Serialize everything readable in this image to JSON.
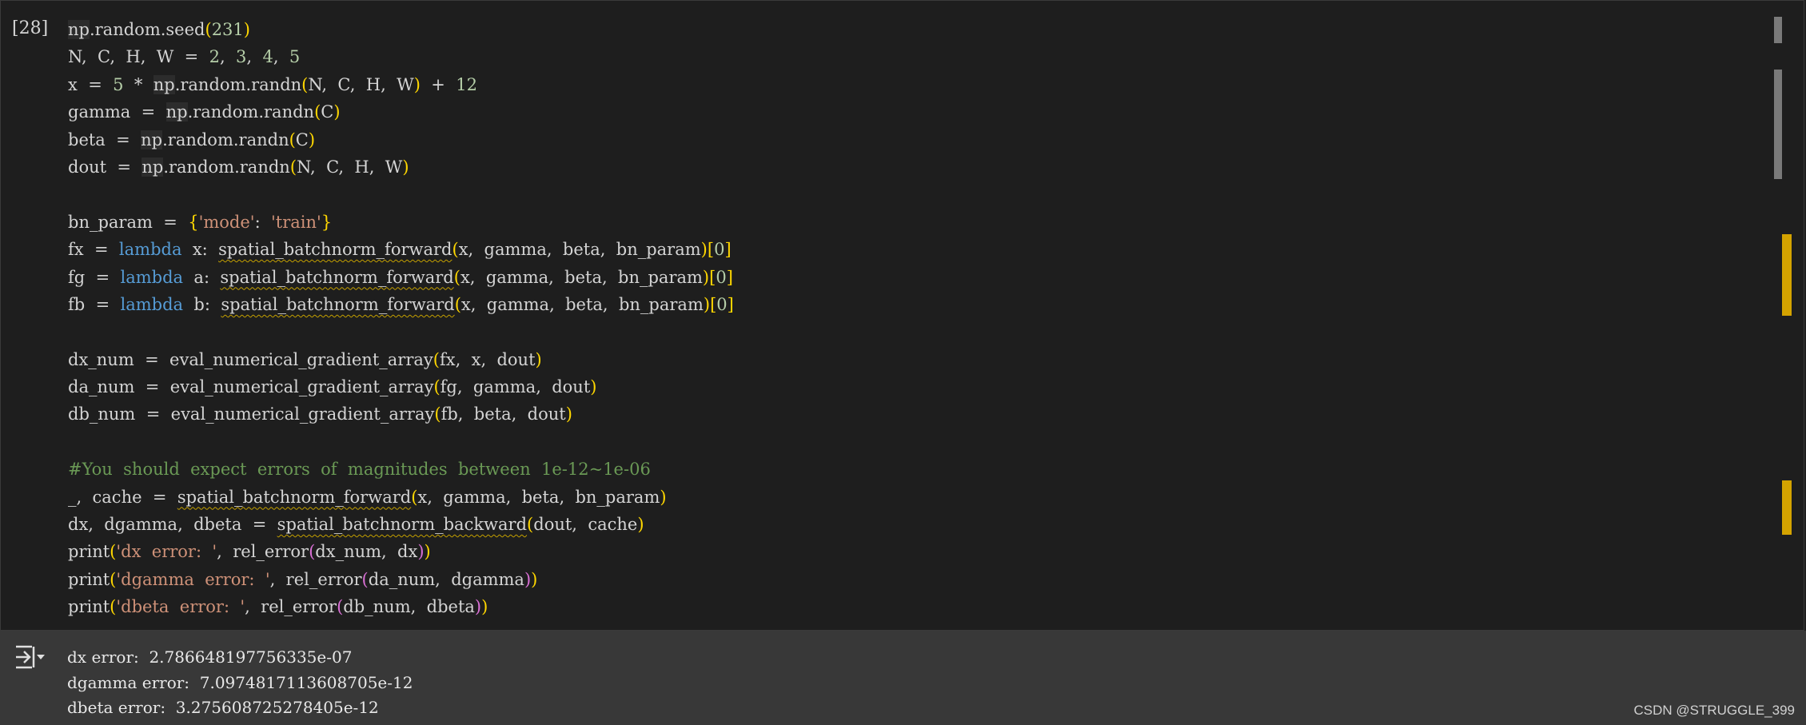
{
  "cell": {
    "execution_count": "[28]",
    "code_lines": [
      [
        [
          "np",
          "np"
        ],
        [
          "plain",
          ".random.seed"
        ],
        [
          "br",
          "("
        ],
        [
          "num",
          "231"
        ],
        [
          "br",
          ")"
        ]
      ],
      [
        [
          "plain",
          "N,  C,  H,  W  =  "
        ],
        [
          "num",
          "2"
        ],
        [
          "plain",
          ",  "
        ],
        [
          "num",
          "3"
        ],
        [
          "plain",
          ",  "
        ],
        [
          "num",
          "4"
        ],
        [
          "plain",
          ",  "
        ],
        [
          "num",
          "5"
        ]
      ],
      [
        [
          "plain",
          "x  =  "
        ],
        [
          "num",
          "5"
        ],
        [
          "plain",
          "  *  "
        ],
        [
          "np",
          "np"
        ],
        [
          "plain",
          ".random.randn"
        ],
        [
          "br",
          "("
        ],
        [
          "plain",
          "N,  C,  H,  W"
        ],
        [
          "br",
          ")"
        ],
        [
          "plain",
          "  +  "
        ],
        [
          "num",
          "12"
        ]
      ],
      [
        [
          "plain",
          "gamma  =  "
        ],
        [
          "np",
          "np"
        ],
        [
          "plain",
          ".random.randn"
        ],
        [
          "br",
          "("
        ],
        [
          "plain",
          "C"
        ],
        [
          "br",
          ")"
        ]
      ],
      [
        [
          "plain",
          "beta  =  "
        ],
        [
          "np",
          "np"
        ],
        [
          "plain",
          ".random.randn"
        ],
        [
          "br",
          "("
        ],
        [
          "plain",
          "C"
        ],
        [
          "br",
          ")"
        ]
      ],
      [
        [
          "plain",
          "dout  =  "
        ],
        [
          "np",
          "np"
        ],
        [
          "plain",
          ".random.randn"
        ],
        [
          "br",
          "("
        ],
        [
          "plain",
          "N,  C,  H,  W"
        ],
        [
          "br",
          ")"
        ]
      ],
      [],
      [
        [
          "plain",
          "bn_param  =  "
        ],
        [
          "br",
          "{"
        ],
        [
          "str",
          "'mode'"
        ],
        [
          "plain",
          ":  "
        ],
        [
          "str",
          "'train'"
        ],
        [
          "br",
          "}"
        ]
      ],
      [
        [
          "plain",
          "fx  =  "
        ],
        [
          "kw",
          "lambda"
        ],
        [
          "plain",
          "  x:  "
        ],
        [
          "fn",
          "spatial_batchnorm_forward"
        ],
        [
          "br",
          "("
        ],
        [
          "plain",
          "x,  gamma,  beta,  bn_param"
        ],
        [
          "br",
          ")"
        ],
        [
          "br",
          "["
        ],
        [
          "num",
          "0"
        ],
        [
          "br",
          "]"
        ]
      ],
      [
        [
          "plain",
          "fg  =  "
        ],
        [
          "kw",
          "lambda"
        ],
        [
          "plain",
          "  a:  "
        ],
        [
          "fn",
          "spatial_batchnorm_forward"
        ],
        [
          "br",
          "("
        ],
        [
          "plain",
          "x,  gamma,  beta,  bn_param"
        ],
        [
          "br",
          ")"
        ],
        [
          "br",
          "["
        ],
        [
          "num",
          "0"
        ],
        [
          "br",
          "]"
        ]
      ],
      [
        [
          "plain",
          "fb  =  "
        ],
        [
          "kw",
          "lambda"
        ],
        [
          "plain",
          "  b:  "
        ],
        [
          "fn",
          "spatial_batchnorm_forward"
        ],
        [
          "br",
          "("
        ],
        [
          "plain",
          "x,  gamma,  beta,  bn_param"
        ],
        [
          "br",
          ")"
        ],
        [
          "br",
          "["
        ],
        [
          "num",
          "0"
        ],
        [
          "br",
          "]"
        ]
      ],
      [],
      [
        [
          "plain",
          "dx_num  =  eval_numerical_gradient_array"
        ],
        [
          "br",
          "("
        ],
        [
          "plain",
          "fx,  x,  dout"
        ],
        [
          "br",
          ")"
        ]
      ],
      [
        [
          "plain",
          "da_num  =  eval_numerical_gradient_array"
        ],
        [
          "br",
          "("
        ],
        [
          "plain",
          "fg,  gamma,  dout"
        ],
        [
          "br",
          ")"
        ]
      ],
      [
        [
          "plain",
          "db_num  =  eval_numerical_gradient_array"
        ],
        [
          "br",
          "("
        ],
        [
          "plain",
          "fb,  beta,  dout"
        ],
        [
          "br",
          ")"
        ]
      ],
      [],
      [
        [
          "com",
          "#You  should  expect  errors  of  magnitudes  between  1e-12~1e-06"
        ]
      ],
      [
        [
          "plain",
          "_,  cache  =  "
        ],
        [
          "fn",
          "spatial_batchnorm_forward"
        ],
        [
          "br",
          "("
        ],
        [
          "plain",
          "x,  gamma,  beta,  bn_param"
        ],
        [
          "br",
          ")"
        ]
      ],
      [
        [
          "plain",
          "dx,  dgamma,  dbeta  =  "
        ],
        [
          "fn",
          "spatial_batchnorm_backward"
        ],
        [
          "br",
          "("
        ],
        [
          "plain",
          "dout,  cache"
        ],
        [
          "br",
          ")"
        ]
      ],
      [
        [
          "plain",
          "print"
        ],
        [
          "br",
          "("
        ],
        [
          "str",
          "'dx  error:  '"
        ],
        [
          "plain",
          ",  rel_error"
        ],
        [
          "br2",
          "("
        ],
        [
          "plain",
          "dx_num,  dx"
        ],
        [
          "br2",
          ")"
        ],
        [
          "br",
          ")"
        ]
      ],
      [
        [
          "plain",
          "print"
        ],
        [
          "br",
          "("
        ],
        [
          "str",
          "'dgamma  error:  '"
        ],
        [
          "plain",
          ",  rel_error"
        ],
        [
          "br2",
          "("
        ],
        [
          "plain",
          "da_num,  dgamma"
        ],
        [
          "br2",
          ")"
        ],
        [
          "br",
          ")"
        ]
      ],
      [
        [
          "plain",
          "print"
        ],
        [
          "br",
          "("
        ],
        [
          "str",
          "'dbeta  error:  '"
        ],
        [
          "plain",
          ",  rel_error"
        ],
        [
          "br2",
          "("
        ],
        [
          "plain",
          "db_num,  dbeta"
        ],
        [
          "br2",
          ")"
        ],
        [
          "br",
          ")"
        ]
      ]
    ]
  },
  "output": {
    "icon": "output-clear-icon",
    "lines": [
      "dx error:  2.786648197756335e-07",
      "dgamma error:  7.0974817113608705e-12",
      "dbeta error:  3.275608725278405e-12"
    ]
  },
  "watermark": "CSDN @STRUGGLE_399",
  "colors": {
    "background": "#1e1e1e",
    "output_background": "#383838",
    "number": "#b5cea8",
    "string": "#ce9178",
    "keyword": "#569cd6",
    "comment": "#6a9955",
    "bracket": "#ffd700",
    "bracket_nested": "#da70d6",
    "warning_marker": "#d4a300"
  }
}
